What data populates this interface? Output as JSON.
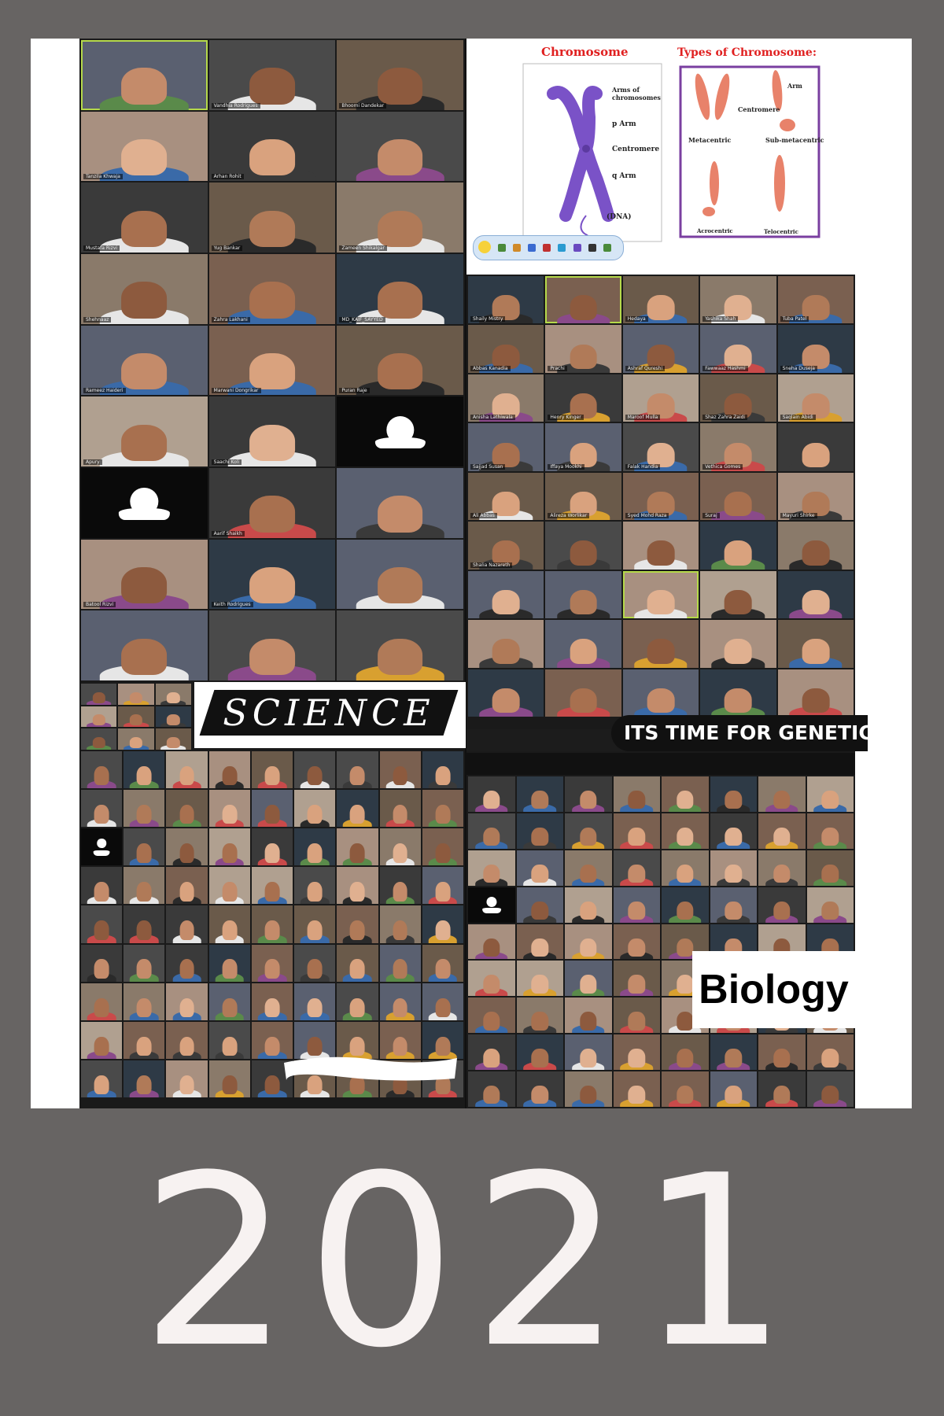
{
  "banners": {
    "science": "SCIENCE",
    "genetics": "ITS TIME FOR GENETIC",
    "biology": "Biology"
  },
  "year": "2021",
  "slide": {
    "title_left": "Chromosome",
    "title_right": "Types of Chromosome:",
    "labels_left": [
      "Arms of chromosomes",
      "p Arm",
      "Centromere",
      "q Arm",
      "(DNA)"
    ],
    "labels_right": [
      "Arm",
      "Centromere",
      "Metacentric",
      "Sub-metacentric",
      "Acrocentric",
      "Telocentric"
    ],
    "colors": {
      "title": "#e02020",
      "chromosome": "#7a52c7",
      "types": "#e8826a",
      "box_border": "#7a3fa0"
    }
  },
  "participants_top_left": [
    "Vandhia Rodrigues",
    "Bhoomi Dandekar",
    "Tanzila Khwaja",
    "Arhan Rohit",
    "Mustafa Rizvi",
    "Yug Bankar",
    "Zameen Shikalgar",
    "Shehnaaz",
    "Zahra Lakhani",
    "MD_KAIF_SAYYED",
    "Rameez Haideri",
    "Marwani Dongrikar",
    "Puran Raje",
    "Apury",
    "Saachi Koli",
    "Aarif Shaikh",
    "Batool Rizvi",
    "Keith Rodrigues"
  ],
  "participants_top_right": [
    "Shaily Mistry",
    "Hedaya",
    "Yashika Shah",
    "Tuba Patel",
    "Abbas Kanadia",
    "Prachi",
    "Ashraf Qureshi",
    "Fawwaaz Hashmi",
    "Sneha Duseja",
    "Anisha Lathiwala",
    "Henry Kinger",
    "Maroof Mulla",
    "Shaz Zahra Zaidi",
    "Saqlain Abidi",
    "Sajjad Susan",
    "Iffaya Mookhi",
    "Falak Handia",
    "Vethica Gomes",
    "Ali Abbas",
    "Alireza Worlikar",
    "Syed Mohd Raza",
    "Suraj",
    "Mayuri Shirke",
    "Shalia Nazareth"
  ],
  "icons": [
    "participant-avatar-icon",
    "microphone-muted-icon",
    "participants-icon",
    "chat-icon",
    "share-screen-icon",
    "record-icon",
    "reactions-icon"
  ]
}
